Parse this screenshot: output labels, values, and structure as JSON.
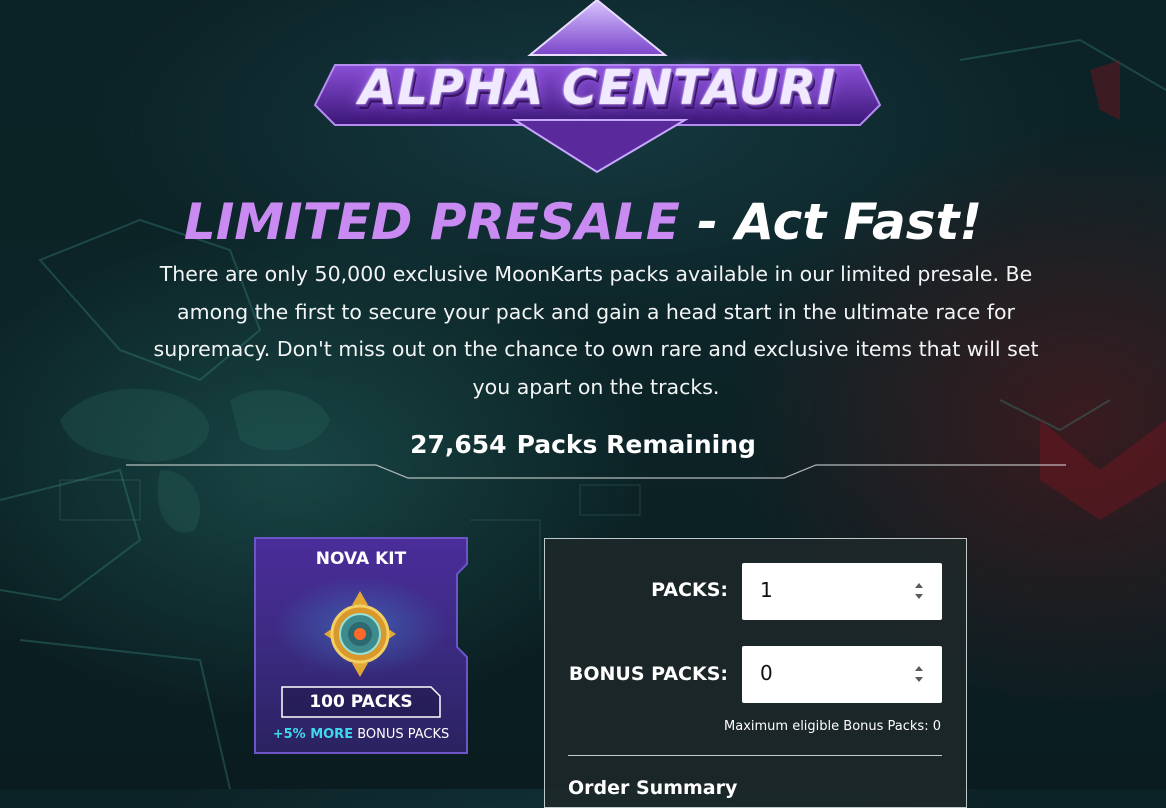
{
  "logo": {
    "text": "ALPHA CENTAURI"
  },
  "hero": {
    "headline_accent": "LIMITED PRESALE",
    "headline_rest": " - Act Fast!",
    "intro": "There are only 50,000 exclusive MoonKarts packs available in our limited presale. Be among the first to secure your pack and gain a head start in the ultimate race for supremacy. Don't miss out on the chance to own rare and exclusive items that will set you apart on the tracks."
  },
  "remaining": {
    "count": "27,654",
    "label": "Packs Remaining"
  },
  "kit": {
    "title": "NOVA KIT",
    "packs": "100 PACKS",
    "bonus_highlight": "+5% MORE",
    "bonus_text": " BONUS PACKS"
  },
  "order": {
    "packs_label": "PACKS:",
    "packs_value": "1",
    "bonus_label": "BONUS PACKS:",
    "bonus_value": "0",
    "max_bonus_note": "Maximum eligible Bonus Packs: 0",
    "summary_title": "Order Summary"
  },
  "colors": {
    "accent_purple": "#c98bf2",
    "bonus_cyan": "#3fd8ef",
    "background": "#0b2226"
  }
}
